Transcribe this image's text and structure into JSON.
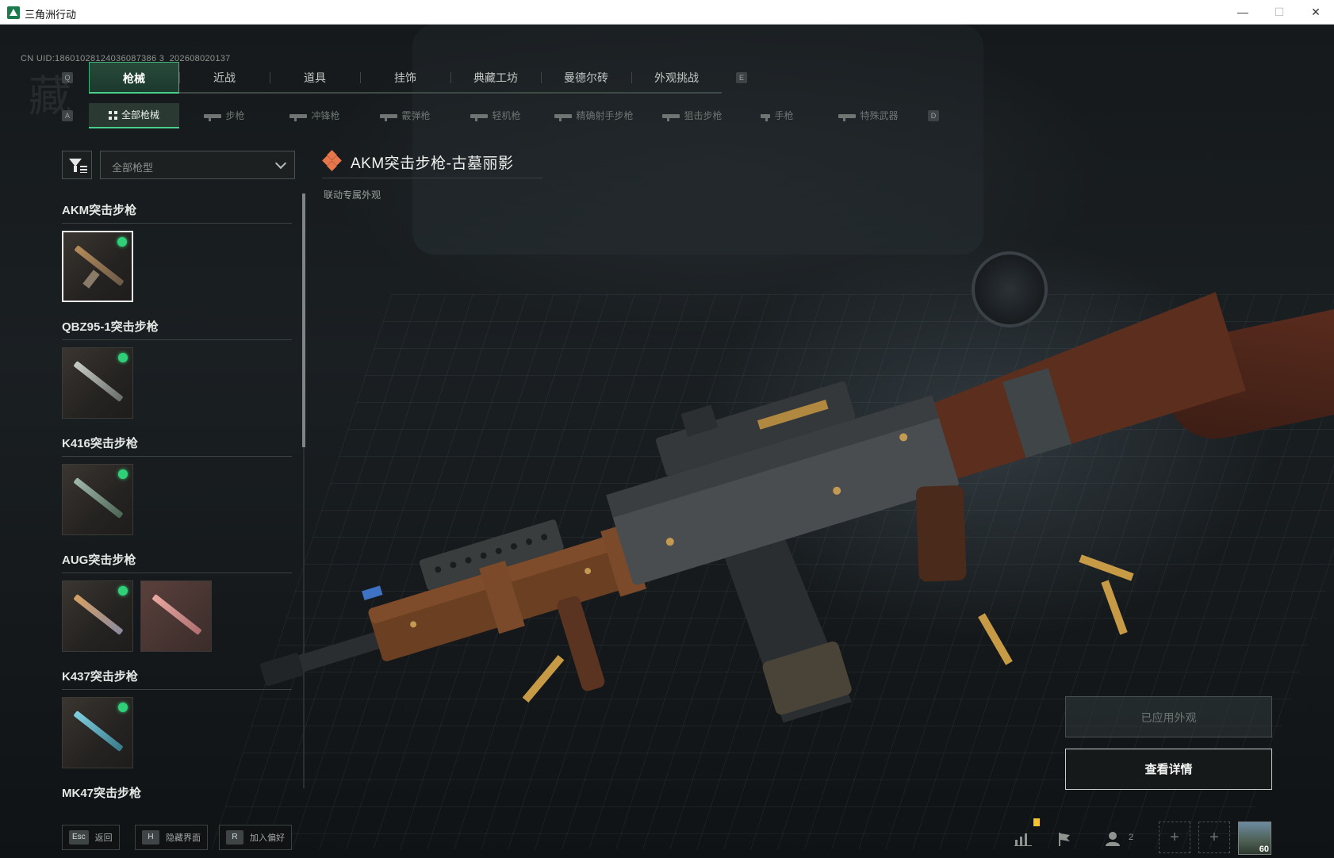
{
  "window": {
    "title": "三角洲行动",
    "minimize": "—",
    "maximize": "☐",
    "close": "✕"
  },
  "uid": "CN UID:18601028124036087386 3_202608020137",
  "bg_watermark": "藏",
  "tabs": {
    "prev_key": "Q",
    "next_key": "E",
    "items": [
      "枪械",
      "近战",
      "道具",
      "挂饰",
      "典藏工坊",
      "曼德尔砖",
      "外观挑战"
    ],
    "active": "枪械"
  },
  "subtabs": {
    "prev_key": "A",
    "next_key": "D",
    "items": [
      "全部枪械",
      "步枪",
      "冲锋枪",
      "霰弹枪",
      "轻机枪",
      "精确射手步枪",
      "狙击步枪",
      "手枪",
      "特殊武器"
    ],
    "active": "全部枪械"
  },
  "filter": {
    "select_value": "全部枪型"
  },
  "weapon_list": [
    {
      "name": "AKM突击步枪",
      "skins": [
        {
          "id": "akm-1",
          "equipped": true,
          "selected": true
        }
      ]
    },
    {
      "name": "QBZ95-1突击步枪",
      "skins": [
        {
          "id": "qbz-1",
          "equipped": true,
          "selected": false
        }
      ]
    },
    {
      "name": "K416突击步枪",
      "skins": [
        {
          "id": "k416-1",
          "equipped": true,
          "selected": false
        }
      ]
    },
    {
      "name": "AUG突击步枪",
      "skins": [
        {
          "id": "aug-1",
          "equipped": true,
          "selected": false
        },
        {
          "id": "aug-2",
          "equipped": false,
          "selected": false
        }
      ]
    },
    {
      "name": "K437突击步枪",
      "skins": [
        {
          "id": "k437-1",
          "equipped": true,
          "selected": false
        }
      ]
    },
    {
      "name": "MK47突击步枪",
      "skins": []
    }
  ],
  "detail": {
    "title": "AKM突击步枪-古墓丽影",
    "subtitle": "联动专属外观"
  },
  "actions": {
    "applied": "已应用外观",
    "view_details": "查看详情"
  },
  "bottom_hints": [
    {
      "key": "Esc",
      "label": "返回"
    },
    {
      "key": "H",
      "label": "隐藏界面"
    },
    {
      "key": "R",
      "label": "加入偏好"
    }
  ],
  "status": {
    "team_count": "2",
    "level": "60",
    "add_slot": "+"
  },
  "colors": {
    "accent_green": "#48d08a",
    "equipped_dot": "#2fd178",
    "title_diamond": "#e7764a"
  }
}
